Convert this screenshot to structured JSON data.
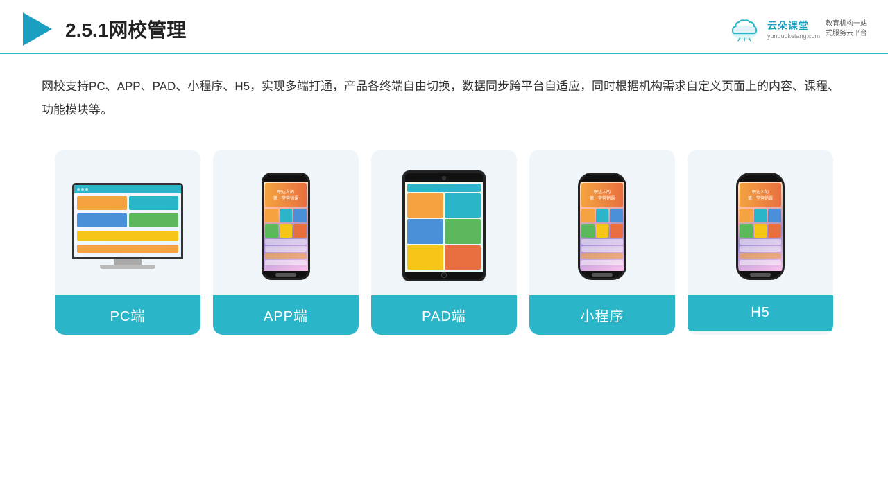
{
  "header": {
    "title": "2.5.1网校管理",
    "logo_name": "云朵课堂",
    "logo_url": "yunduoketang.com",
    "logo_slogan": "教育机构一站\n式服务云平台"
  },
  "description": {
    "text": "网校支持PC、APP、PAD、小程序、H5，实现多端打通，产品各终端自由切换，数据同步跨平台自适应，同时根据机构需求自定义页面上的内容、课程、功能模块等。"
  },
  "cards": [
    {
      "id": "pc",
      "label": "PC端"
    },
    {
      "id": "app",
      "label": "APP端"
    },
    {
      "id": "pad",
      "label": "PAD端"
    },
    {
      "id": "miniprogram",
      "label": "小程序"
    },
    {
      "id": "h5",
      "label": "H5"
    }
  ]
}
